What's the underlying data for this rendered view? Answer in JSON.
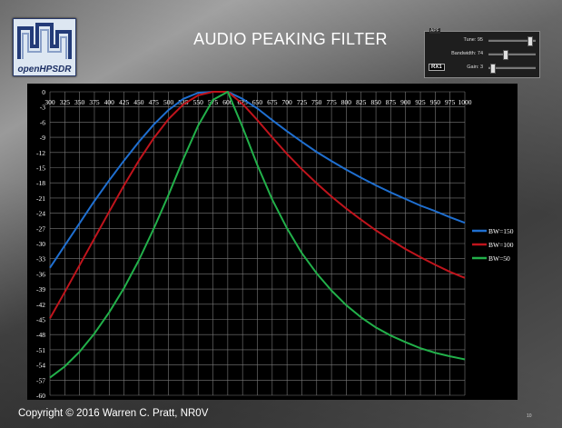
{
  "slide": {
    "title": "AUDIO PEAKING FILTER",
    "footer": "Copyright © 2016 Warren C. Pratt, NR0V",
    "page_number": "10"
  },
  "logo": {
    "text": "openHPSDR",
    "icon": "openhpsdr-logo"
  },
  "apf_panel": {
    "legend": "APF",
    "rx_label": "RX1",
    "controls": [
      {
        "label": "Tune: 95",
        "level": 0.92
      },
      {
        "label": "Bandwidth: 74",
        "level": 0.35
      },
      {
        "label": "Gain: 3",
        "level": 0.05
      }
    ]
  },
  "chart_data": {
    "type": "line",
    "title": "",
    "xlabel": "",
    "ylabel": "",
    "xlim": [
      300,
      1000
    ],
    "ylim": [
      -60,
      0
    ],
    "x_ticks": [
      300,
      325,
      350,
      375,
      400,
      425,
      450,
      475,
      500,
      525,
      550,
      575,
      600,
      625,
      650,
      675,
      700,
      725,
      750,
      775,
      800,
      825,
      850,
      875,
      900,
      925,
      950,
      975,
      1000
    ],
    "y_ticks": [
      0,
      -3,
      -6,
      -9,
      -12,
      -15,
      -18,
      -21,
      -24,
      -27,
      -30,
      -33,
      -36,
      -39,
      -42,
      -45,
      -48,
      -51,
      -54,
      -57,
      -60
    ],
    "grid": true,
    "legend_position": "right",
    "x": [
      300,
      325,
      350,
      375,
      400,
      425,
      450,
      475,
      500,
      525,
      550,
      575,
      600,
      625,
      650,
      675,
      700,
      725,
      750,
      775,
      800,
      825,
      850,
      875,
      900,
      925,
      950,
      975,
      1000
    ],
    "series": [
      {
        "name": "BW=150",
        "color": "#1f6fd0",
        "values": [
          -34.8,
          -30.4,
          -26.0,
          -21.6,
          -17.5,
          -13.6,
          -9.9,
          -6.5,
          -3.6,
          -1.4,
          -0.2,
          0,
          0,
          -1.4,
          -3.3,
          -5.6,
          -7.8,
          -9.9,
          -11.9,
          -13.7,
          -15.4,
          -17.0,
          -18.5,
          -19.9,
          -21.2,
          -22.5,
          -23.6,
          -24.8,
          -25.9
        ]
      },
      {
        "name": "BW=100",
        "color": "#c0141c",
        "values": [
          -44.8,
          -39.6,
          -34.3,
          -29.0,
          -23.7,
          -18.5,
          -13.6,
          -9.2,
          -5.4,
          -2.5,
          -0.7,
          0,
          0,
          -2.4,
          -5.6,
          -9.0,
          -12.3,
          -15.3,
          -18.1,
          -20.7,
          -23.1,
          -25.3,
          -27.4,
          -29.3,
          -31.1,
          -32.7,
          -34.2,
          -35.6,
          -36.8
        ]
      },
      {
        "name": "BW=50",
        "color": "#22b04a",
        "values": [
          -56.5,
          -54.3,
          -51.4,
          -47.8,
          -43.6,
          -38.8,
          -33.3,
          -27.1,
          -20.4,
          -13.3,
          -6.7,
          -1.6,
          0,
          -7.0,
          -14.5,
          -21.3,
          -27.0,
          -31.9,
          -35.9,
          -39.3,
          -42.2,
          -44.6,
          -46.6,
          -48.2,
          -49.5,
          -50.7,
          -51.6,
          -52.3,
          -52.9
        ]
      }
    ]
  }
}
